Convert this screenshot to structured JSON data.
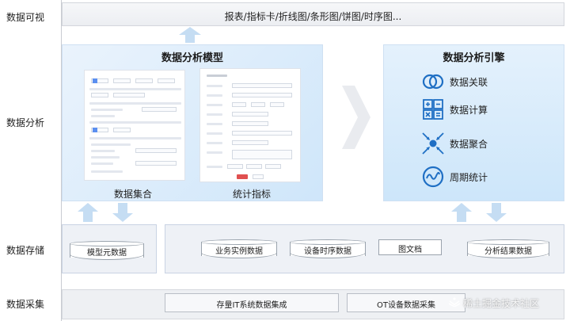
{
  "rows": {
    "visualization": "数据可视",
    "analysis": "数据分析",
    "storage": "数据存储",
    "collection": "数据采集"
  },
  "visualization_bar": "报表/指标卡/折线图/条形图/饼图/时序图...",
  "model_panel": {
    "title": "数据分析模型",
    "left_caption": "数据集合",
    "right_caption": "统计指标"
  },
  "engine_panel": {
    "title": "数据分析引擎",
    "items": [
      {
        "label": "数据关联",
        "icon": "venn-circles-icon"
      },
      {
        "label": "数据计算",
        "icon": "calculator-icon"
      },
      {
        "label": "数据聚合",
        "icon": "aggregate-arrows-icon"
      },
      {
        "label": "周期统计",
        "icon": "wave-cycle-icon"
      }
    ]
  },
  "storage": {
    "left": [
      "模型元数据"
    ],
    "right": [
      "业务实例数据",
      "设备时序数据",
      "图文档",
      "分析结果数据"
    ]
  },
  "collection": [
    "存量IT系统数据集成",
    "OT设备数据采集"
  ],
  "watermark": "稀土掘金技术社区",
  "colors": {
    "panel_blue": "#cfe6fa",
    "arrow_blue": "#c5ddf3",
    "icon_blue": "#1f6fc4",
    "band_gray": "#eef1f6"
  }
}
